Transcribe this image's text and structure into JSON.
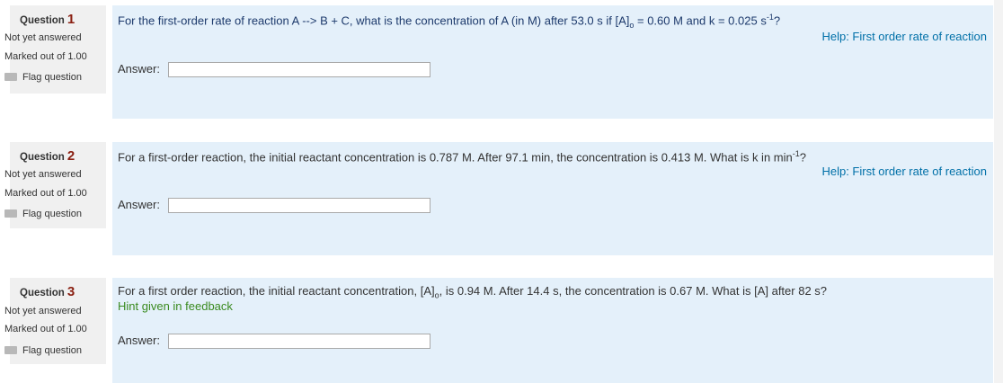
{
  "questions": [
    {
      "label": "Question",
      "number": "1",
      "status": "Not yet answered",
      "marks": "Marked out of 1.00",
      "flag_label": "Flag question",
      "text_parts": {
        "a": "For the first-order rate of reaction A --> B + C, what is the concentration of A (in M) after 53.0 s if [A]",
        "sub": "o",
        "b": " = 0.60 M and k = 0.025 s",
        "sup": "-1",
        "c": "?"
      },
      "help_link": "Help: First order rate of reaction",
      "answer_label": "Answer:",
      "answer_value": ""
    },
    {
      "label": "Question",
      "number": "2",
      "status": "Not yet answered",
      "marks": "Marked out of 1.00",
      "flag_label": "Flag question",
      "text_parts": {
        "a": "For a first-order reaction, the initial reactant concentration is 0.787 M. After 97.1 min, the concentration is 0.413 M. What is k in min",
        "sup": "-1",
        "c": "?"
      },
      "help_link": "Help: First order rate of reaction",
      "answer_label": "Answer:",
      "answer_value": ""
    },
    {
      "label": "Question",
      "number": "3",
      "status": "Not yet answered",
      "marks": "Marked out of 1.00",
      "flag_label": "Flag question",
      "text_parts": {
        "a": "For a first order reaction, the initial reactant concentration, [A]",
        "sub": "o",
        "b": ", is 0.94 M. After 14.4 s, the concentration is 0.67 M. What is [A] after 82 s?"
      },
      "hint": "Hint given in feedback",
      "answer_label": "Answer:",
      "answer_value": ""
    }
  ]
}
